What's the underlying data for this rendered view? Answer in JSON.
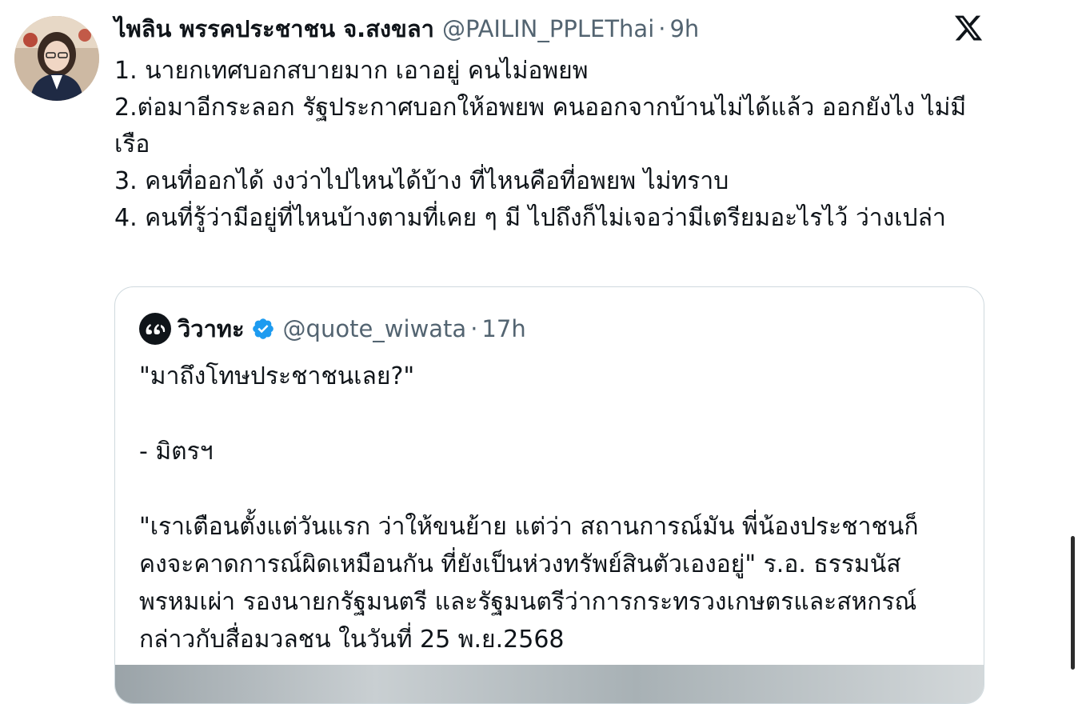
{
  "tweet": {
    "display_name": "ไพลิน พรรคประชาชน จ.สงขลา",
    "handle": "@PAILIN_PPLEThai",
    "separator": "·",
    "time": "9h",
    "icons": {
      "platform_logo": "x-logo-icon",
      "avatar": "profile-photo"
    },
    "body_lines": [
      "1. นายกเทศบอกสบายมาก เอาอยู่ คนไม่อพยพ",
      "2.ต่อมาอีกระลอก รัฐประกาศบอกให้อพยพ คนออกจากบ้านไม่ได้แล้ว ออกยังไง ไม่มีเรือ",
      "3. คนที่ออกได้ งงว่าไปไหนได้บ้าง ที่ไหนคือที่อพยพ ไม่ทราบ",
      "4. คนที่รู้ว่ามีอยู่ที่ไหนบ้างตามที่เคย ๆ มี ไปถึงก็ไม่เจอว่ามีเตรียมอะไรไว้ ว่างเปล่า"
    ]
  },
  "quote": {
    "display_name": "วิวาทะ",
    "handle": "@quote_wiwata",
    "separator": "·",
    "time": "17h",
    "verified": true,
    "icons": {
      "avatar": "quote-marks-icon",
      "badge": "verified-badge-icon"
    },
    "colors": {
      "verified": "#1d9bf0"
    },
    "text_line_1": "\"มาถึงโทษประชาชนเลย?\"",
    "text_line_2": "- มิตรฯ",
    "text_line_3": "\"เราเตือนตั้งแต่วันแรก ว่าให้ขนย้าย แต่ว่า สถานการณ์มัน พี่น้องประชาชนก็คงจะคาดการณ์ผิดเหมือนกัน ที่ยังเป็นห่วงทรัพย์สินตัวเองอยู่\" ร.อ. ธรรมนัส พรหมเผ่า รองนายกรัฐมนตรี และรัฐมนตรีว่าการกระทรวงเกษตรและสหกรณ์ กล่าวกับสื่อมวลชน ในวันที่ 25 พ.ย.2568"
  }
}
